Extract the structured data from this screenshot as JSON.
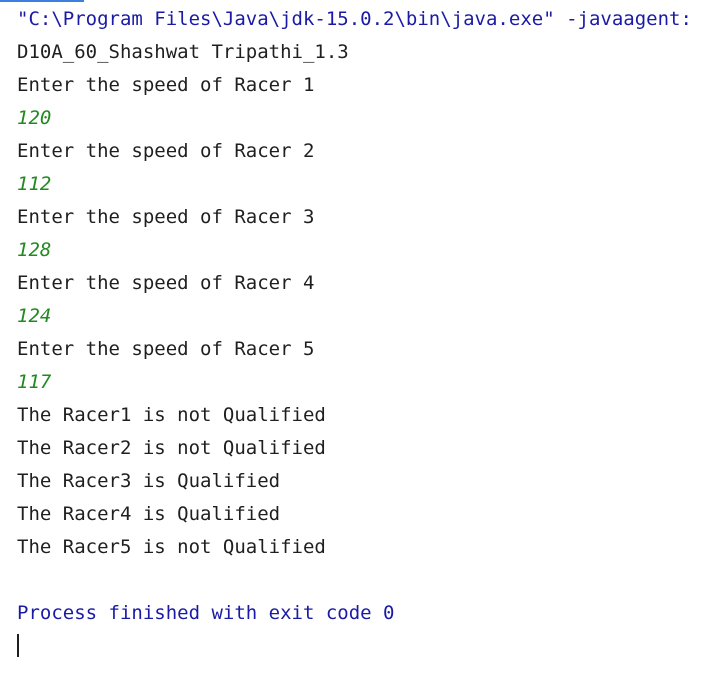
{
  "console": {
    "command": "\"C:\\Program Files\\Java\\jdk-15.0.2\\bin\\java.exe\" -javaagent:",
    "header": "D10A_60_Shashwat Tripathi_1.3",
    "prompts": [
      "Enter the speed of Racer 1",
      "Enter the speed of Racer 2",
      "Enter the speed of Racer 3",
      "Enter the speed of Racer 4",
      "Enter the speed of Racer 5"
    ],
    "inputs": [
      "120",
      "112",
      "128",
      "124",
      "117"
    ],
    "results": [
      "The Racer1 is not Qualified",
      "The Racer2 is not Qualified",
      "The Racer3 is Qualified",
      "The Racer4 is Qualified",
      "The Racer5 is not Qualified"
    ],
    "exit_message": "Process finished with exit code 0"
  },
  "colors": {
    "command_text": "#1a1aa6",
    "output_text": "#1f1f1f",
    "user_input_text": "#208a20",
    "tab_accent": "#3d7fe0"
  }
}
